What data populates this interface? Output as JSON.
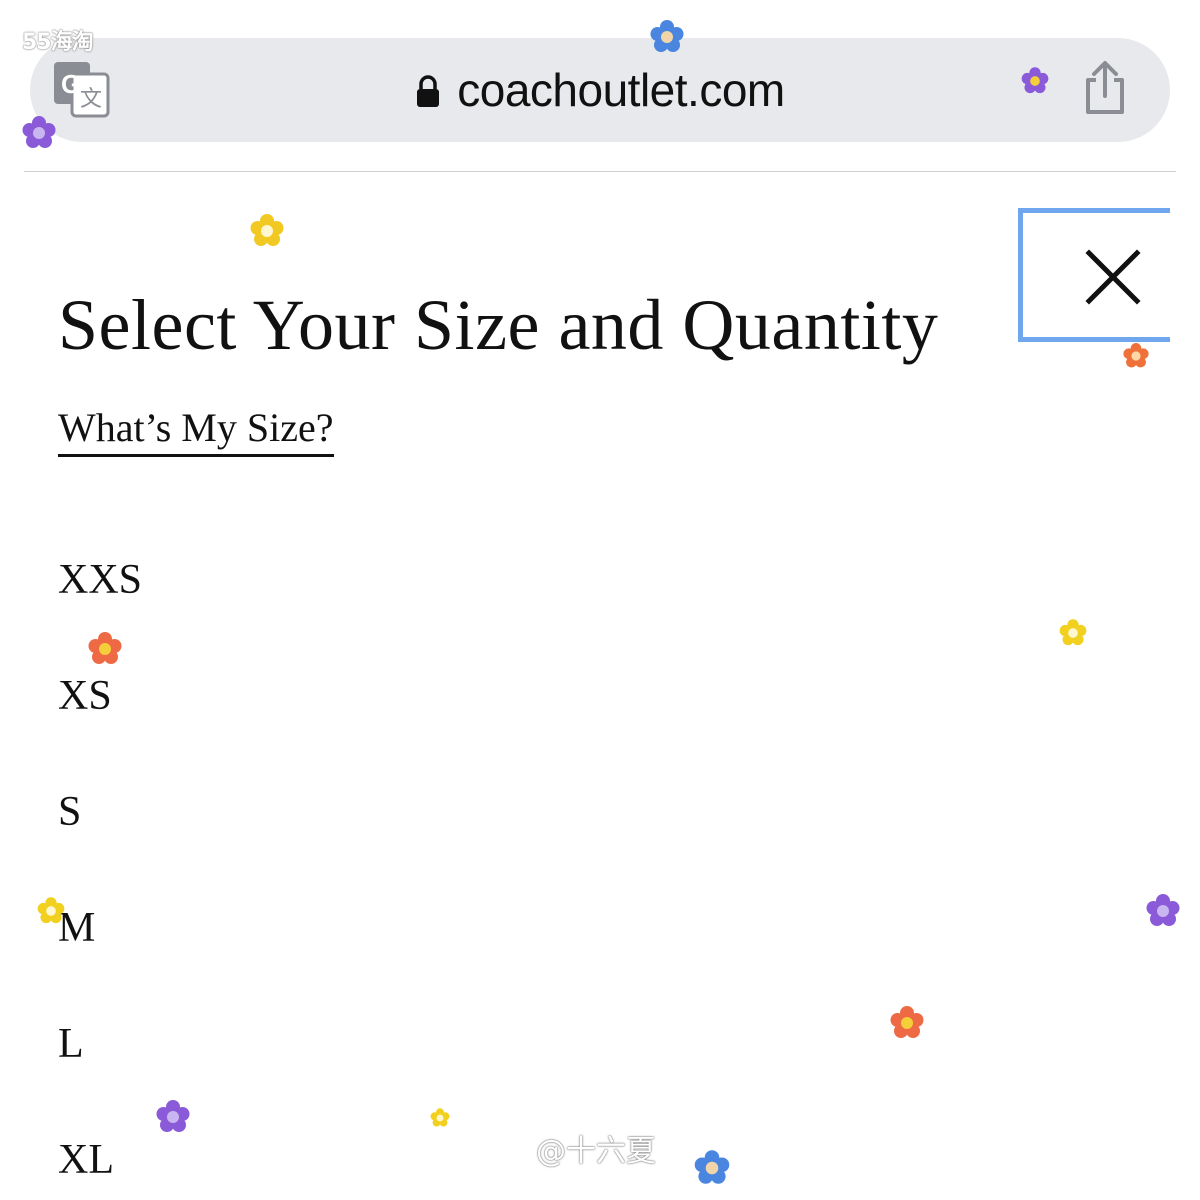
{
  "watermarks": {
    "top": "55海淘",
    "bottom": "@十六夏"
  },
  "browser": {
    "url": "coachoutlet.com",
    "icons": [
      "google-translate-icon",
      "lock-icon",
      "share-icon"
    ]
  },
  "modal": {
    "title": "Select Your Size and Quantity",
    "size_guide_link": "What’s My Size?",
    "close_icon": "close-icon",
    "sizes": [
      "XXS",
      "XS",
      "S",
      "M",
      "L",
      "XL"
    ]
  },
  "colors": {
    "url_bar_bg": "#e8e9ec",
    "close_focus_border": "#6fa6ee",
    "text": "#111111"
  },
  "decorations": {
    "sticker": "flower-stickers"
  }
}
